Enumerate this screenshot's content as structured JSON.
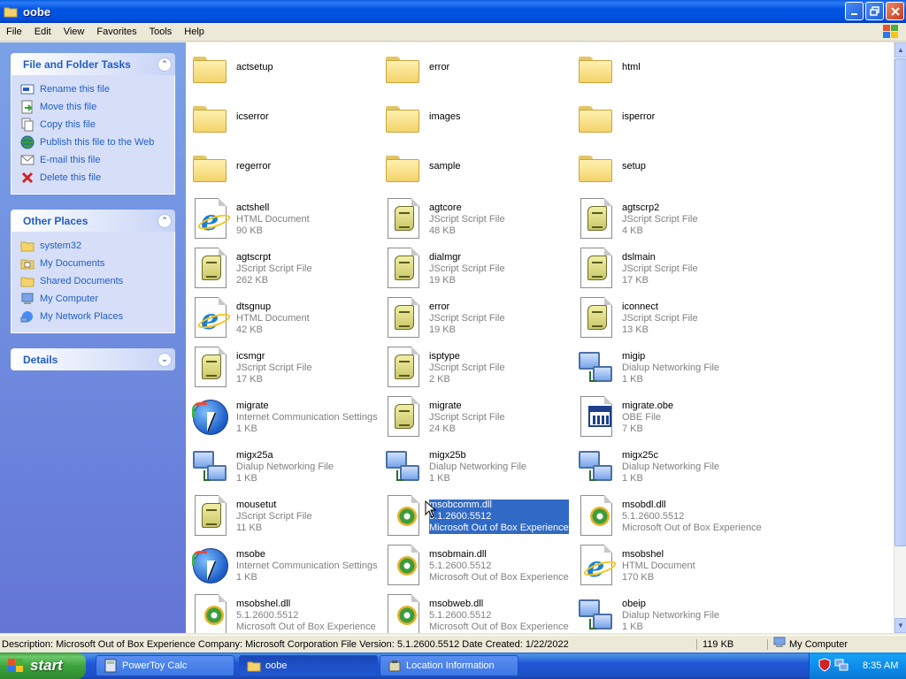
{
  "window": {
    "title": "oobe",
    "controls": [
      "minimize",
      "maximize",
      "close"
    ]
  },
  "menu": [
    "File",
    "Edit",
    "View",
    "Favorites",
    "Tools",
    "Help"
  ],
  "left_pane": {
    "file_tasks": {
      "title": "File and Folder Tasks",
      "items": [
        {
          "label": "Rename this file",
          "icon": "rename-icon"
        },
        {
          "label": "Move this file",
          "icon": "move-icon"
        },
        {
          "label": "Copy this file",
          "icon": "copy-icon"
        },
        {
          "label": "Publish this file to the Web",
          "icon": "publish-icon"
        },
        {
          "label": "E-mail this file",
          "icon": "email-icon"
        },
        {
          "label": "Delete this file",
          "icon": "delete-icon"
        }
      ]
    },
    "other_places": {
      "title": "Other Places",
      "items": [
        {
          "label": "system32",
          "icon": "folder-icon"
        },
        {
          "label": "My Documents",
          "icon": "my-documents-icon"
        },
        {
          "label": "Shared Documents",
          "icon": "folder-icon"
        },
        {
          "label": "My Computer",
          "icon": "computer-icon"
        },
        {
          "label": "My Network Places",
          "icon": "network-places-icon"
        }
      ]
    },
    "details": {
      "title": "Details"
    }
  },
  "files": [
    {
      "name": "actsetup",
      "type": "",
      "size": "",
      "icon": "folder"
    },
    {
      "name": "error",
      "type": "",
      "size": "",
      "icon": "folder"
    },
    {
      "name": "html",
      "type": "",
      "size": "",
      "icon": "folder"
    },
    {
      "name": "icserror",
      "type": "",
      "size": "",
      "icon": "folder"
    },
    {
      "name": "images",
      "type": "",
      "size": "",
      "icon": "folder"
    },
    {
      "name": "isperror",
      "type": "",
      "size": "",
      "icon": "folder"
    },
    {
      "name": "regerror",
      "type": "",
      "size": "",
      "icon": "folder"
    },
    {
      "name": "sample",
      "type": "",
      "size": "",
      "icon": "folder"
    },
    {
      "name": "setup",
      "type": "",
      "size": "",
      "icon": "folder"
    },
    {
      "name": "actshell",
      "type": "HTML Document",
      "size": "90 KB",
      "icon": "html"
    },
    {
      "name": "agtcore",
      "type": "JScript Script File",
      "size": "48 KB",
      "icon": "script"
    },
    {
      "name": "agtscrp2",
      "type": "JScript Script File",
      "size": "4 KB",
      "icon": "script"
    },
    {
      "name": "agtscrpt",
      "type": "JScript Script File",
      "size": "262 KB",
      "icon": "script"
    },
    {
      "name": "dialmgr",
      "type": "JScript Script File",
      "size": "19 KB",
      "icon": "script"
    },
    {
      "name": "dslmain",
      "type": "JScript Script File",
      "size": "17 KB",
      "icon": "script"
    },
    {
      "name": "dtsgnup",
      "type": "HTML Document",
      "size": "42 KB",
      "icon": "html"
    },
    {
      "name": "error",
      "type": "JScript Script File",
      "size": "19 KB",
      "icon": "script"
    },
    {
      "name": "iconnect",
      "type": "JScript Script File",
      "size": "13 KB",
      "icon": "script"
    },
    {
      "name": "icsmgr",
      "type": "JScript Script File",
      "size": "17 KB",
      "icon": "script"
    },
    {
      "name": "isptype",
      "type": "JScript Script File",
      "size": "2 KB",
      "icon": "script"
    },
    {
      "name": "migip",
      "type": "Dialup Networking File",
      "size": "1 KB",
      "icon": "network"
    },
    {
      "name": "migrate",
      "type": "Internet Communication Settings",
      "size": "1 KB",
      "icon": "ics"
    },
    {
      "name": "migrate",
      "type": "JScript Script File",
      "size": "24 KB",
      "icon": "script"
    },
    {
      "name": "migrate.obe",
      "type": "OBE File",
      "size": "7 KB",
      "icon": "obe"
    },
    {
      "name": "migx25a",
      "type": "Dialup Networking File",
      "size": "1 KB",
      "icon": "network"
    },
    {
      "name": "migx25b",
      "type": "Dialup Networking File",
      "size": "1 KB",
      "icon": "network"
    },
    {
      "name": "migx25c",
      "type": "Dialup Networking File",
      "size": "1 KB",
      "icon": "network"
    },
    {
      "name": "mousetut",
      "type": "JScript Script File",
      "size": "11 KB",
      "icon": "script"
    },
    {
      "name": "msobcomm.dll",
      "type": "5.1.2600.5512",
      "size": "Microsoft Out of Box Experience",
      "icon": "dll",
      "selected": true
    },
    {
      "name": "msobdl.dll",
      "type": "5.1.2600.5512",
      "size": "Microsoft Out of Box Experience",
      "icon": "dll"
    },
    {
      "name": "msobe",
      "type": "Internet Communication Settings",
      "size": "1 KB",
      "icon": "ics"
    },
    {
      "name": "msobmain.dll",
      "type": "5.1.2600.5512",
      "size": "Microsoft Out of Box Experience",
      "icon": "dll"
    },
    {
      "name": "msobshel",
      "type": "HTML Document",
      "size": "170 KB",
      "icon": "html"
    },
    {
      "name": "msobshel.dll",
      "type": "5.1.2600.5512",
      "size": "Microsoft Out of Box Experience",
      "icon": "dll"
    },
    {
      "name": "msobweb.dll",
      "type": "5.1.2600.5512",
      "size": "Microsoft Out of Box Experience",
      "icon": "dll"
    },
    {
      "name": "obeip",
      "type": "Dialup Networking File",
      "size": "1 KB",
      "icon": "network"
    }
  ],
  "status": {
    "description": "Description: Microsoft Out of Box Experience Company: Microsoft Corporation File Version: 5.1.2600.5512 Date Created: 1/22/2022",
    "size": "119 KB",
    "zone": "My Computer"
  },
  "taskbar": {
    "start": "start",
    "tasks": [
      {
        "label": "PowerToy Calc",
        "active": false
      },
      {
        "label": "oobe",
        "active": true
      },
      {
        "label": "Location Information",
        "active": false
      }
    ],
    "clock": "8:35 AM"
  }
}
